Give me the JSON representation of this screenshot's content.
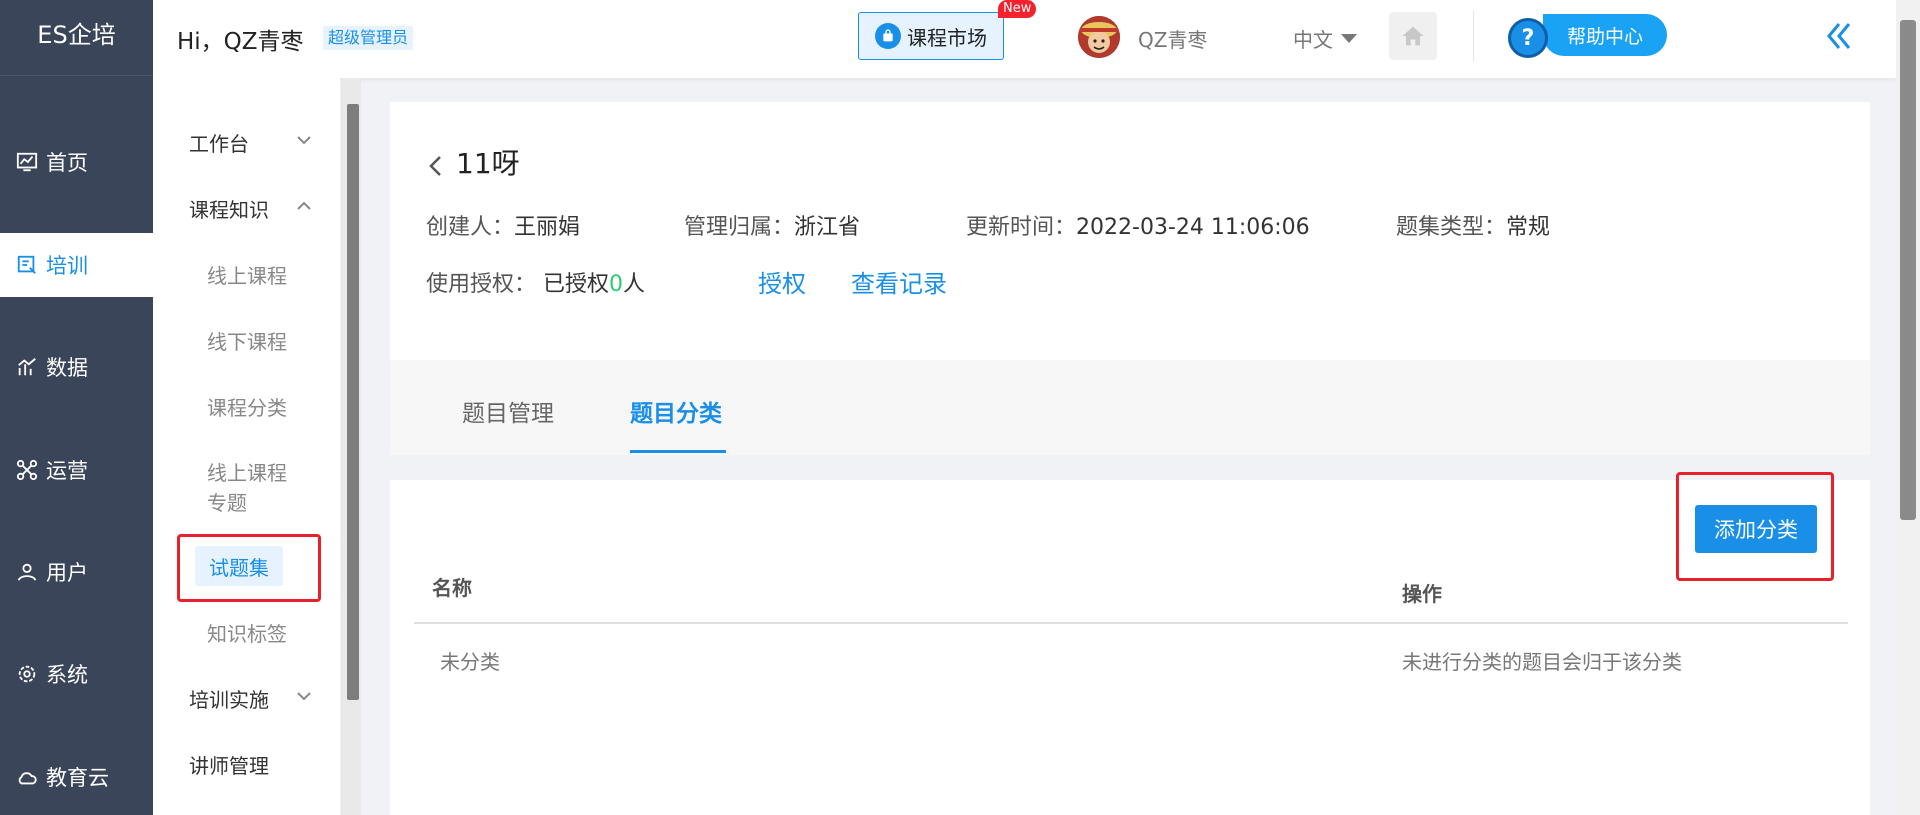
{
  "brand": "ES企培",
  "leftnav": {
    "items": [
      {
        "label": "首页",
        "icon": "monitor-chart-icon"
      },
      {
        "label": "培训",
        "icon": "training-icon"
      },
      {
        "label": "数据",
        "icon": "analytics-icon"
      },
      {
        "label": "运营",
        "icon": "operations-icon"
      },
      {
        "label": "用户",
        "icon": "user-icon"
      },
      {
        "label": "系统",
        "icon": "gear-icon"
      },
      {
        "label": "教育云",
        "icon": "cloud-icon"
      }
    ],
    "active_index": 1
  },
  "header": {
    "greeting": "Hi，QZ青枣",
    "role": "超级管理员",
    "market_label": "课程市场",
    "new_badge": "New",
    "username": "QZ青枣",
    "language": "中文",
    "help_label": "帮助中心",
    "help_glyph": "?"
  },
  "subnav": {
    "workbench": "工作台",
    "course_knowledge": "课程知识",
    "children": [
      "线上课程",
      "线下课程",
      "课程分类",
      "线上课程专题",
      "试题集",
      "知识标签"
    ],
    "active_child": "试题集",
    "training_impl": "培训实施",
    "lecturer": "讲师管理"
  },
  "detail": {
    "title": "11呀",
    "creator_label": "创建人：",
    "creator": "王丽娟",
    "owner_label": "管理归属：",
    "owner": "浙江省",
    "updated_label": "更新时间：",
    "updated": "2022-03-24 11:06:06",
    "type_label": "题集类型：",
    "type": "常规",
    "auth_label": "使用授权：",
    "auth_prefix": "已授权",
    "auth_count": "0",
    "auth_suffix": "人",
    "authorize_link": "授权",
    "records_link": "查看记录"
  },
  "tabs": [
    "题目管理",
    "题目分类"
  ],
  "active_tab": 1,
  "table": {
    "add_button": "添加分类",
    "columns": [
      "名称",
      "操作"
    ],
    "rows": [
      {
        "name": "未分类",
        "action": "未进行分类的题目会归于该分类"
      }
    ]
  },
  "colors": {
    "nav_bg": "#3a4559",
    "accent": "#1a8fe8",
    "highlight": "#e8202a"
  }
}
